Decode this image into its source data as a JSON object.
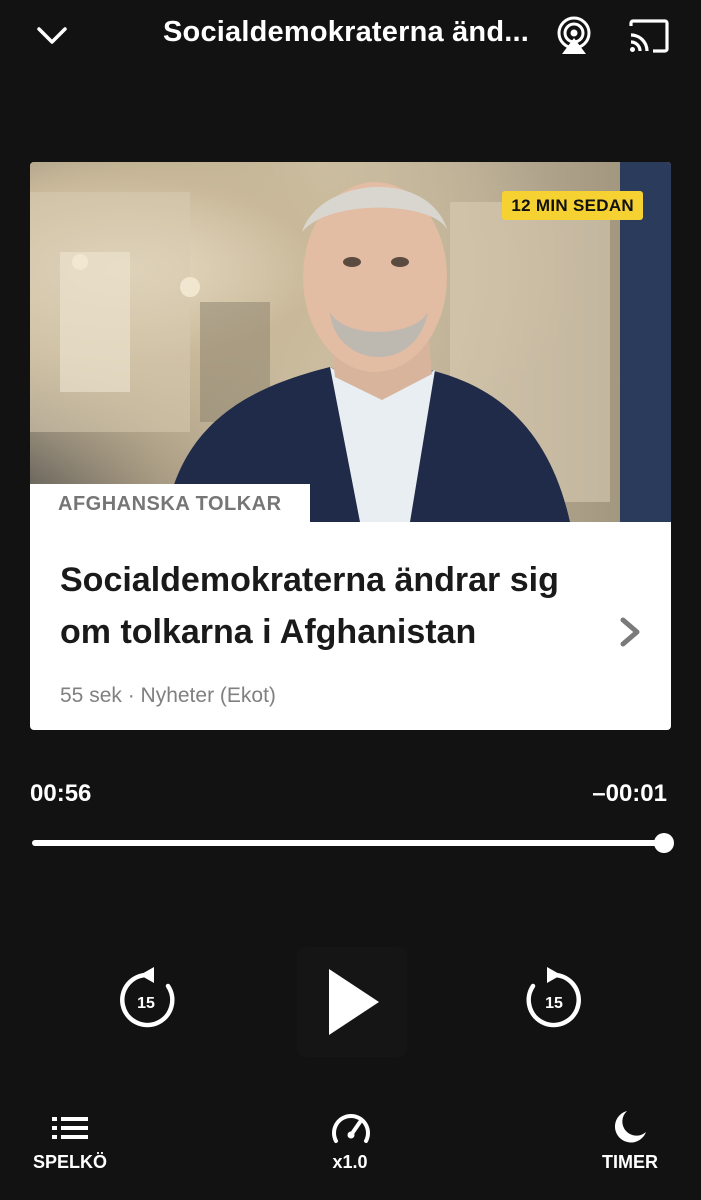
{
  "header": {
    "title": "Socialdemokraterna änd...",
    "collapse_icon": "chevron-down-icon",
    "airplay_icon": "airplay-icon",
    "cast_icon": "cast-icon"
  },
  "episode": {
    "badge": "12 MIN SEDAN",
    "category": "AFGHANSKA TOLKAR",
    "title": "Socialdemokraterna ändrar sig om tolkarna i Afghanistan",
    "meta": "55 sek · Nyheter (Ekot)",
    "badge_color": "#f5d132"
  },
  "player": {
    "elapsed": "00:56",
    "remaining": "–00:01",
    "progress_fraction": 0.98,
    "rewind_seconds": "15",
    "forward_seconds": "15"
  },
  "bottom_bar": {
    "queue_label": "SPELKÖ",
    "speed_label": "x1.0",
    "timer_label": "TIMER"
  }
}
